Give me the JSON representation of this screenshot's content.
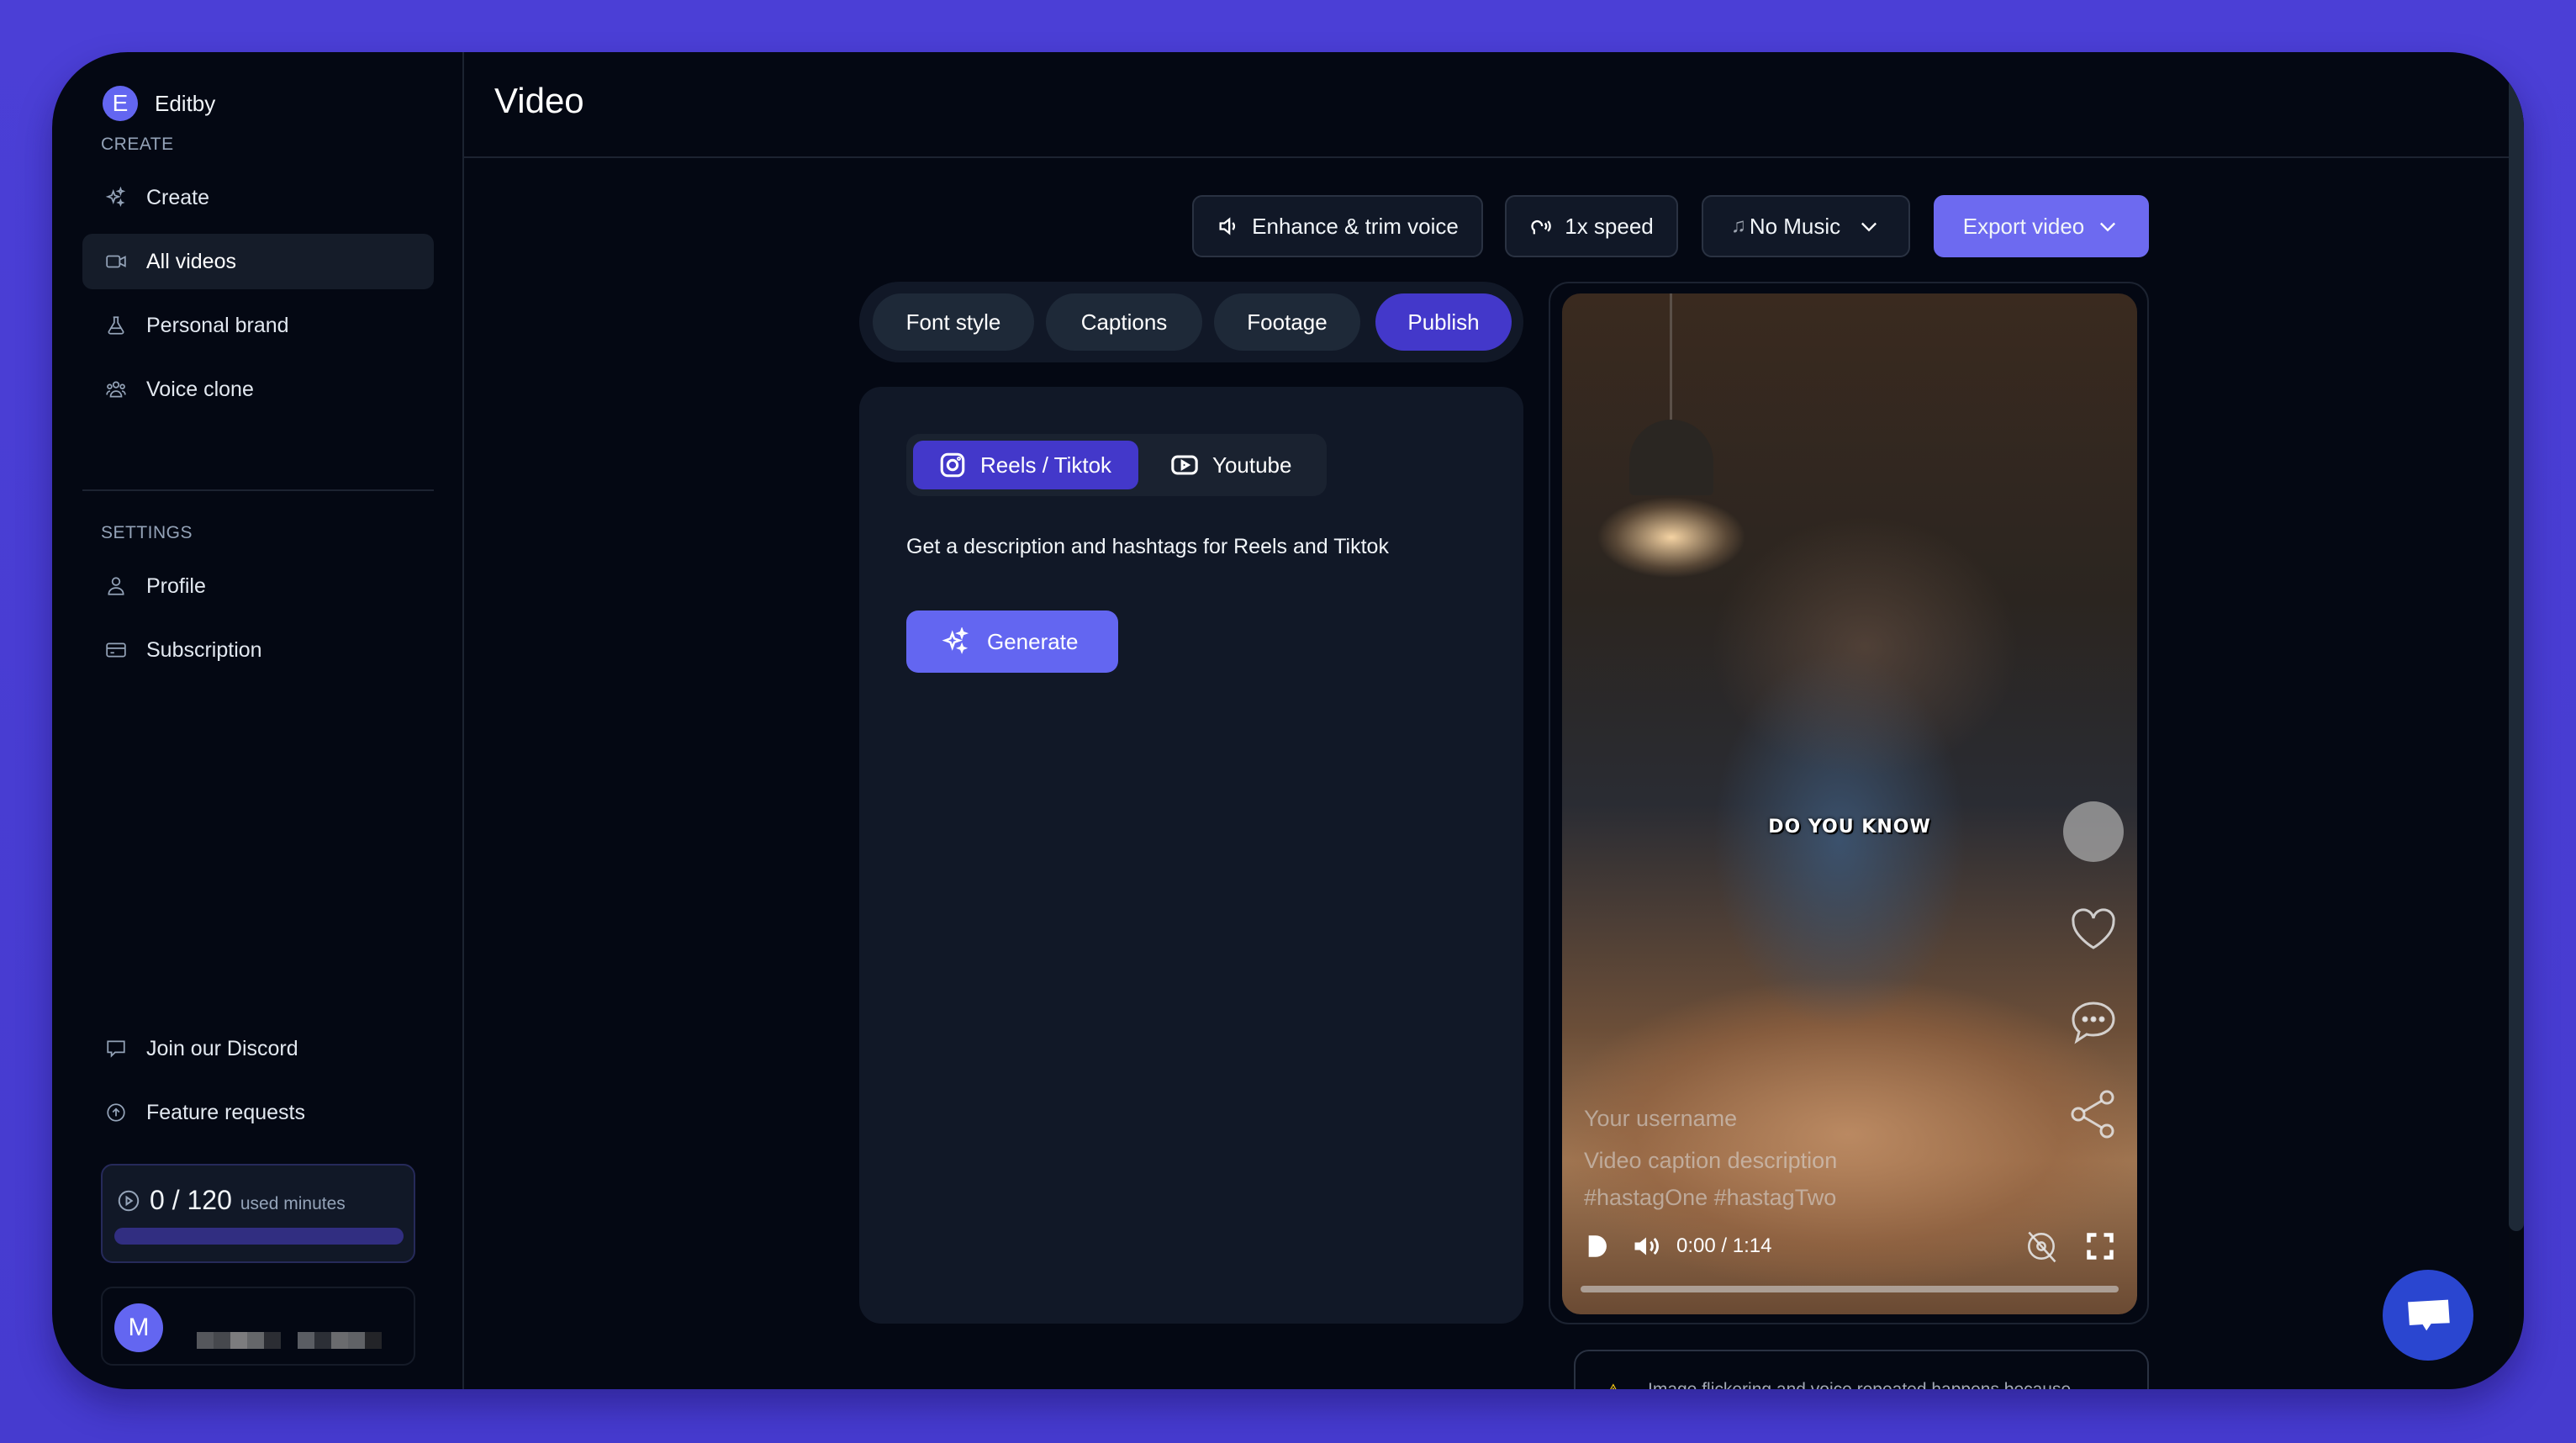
{
  "app": {
    "name": "Editby",
    "logo_letter": "E"
  },
  "sidebar": {
    "create_section": "CREATE",
    "create_items": [
      {
        "label": "Create",
        "icon": "sparkles-icon"
      },
      {
        "label": "All videos",
        "icon": "video-camera-icon",
        "active": true
      },
      {
        "label": "Personal brand",
        "icon": "flask-icon"
      },
      {
        "label": "Voice clone",
        "icon": "users-icon"
      }
    ],
    "settings_section": "SETTINGS",
    "settings_items": [
      {
        "label": "Profile",
        "icon": "user-icon"
      },
      {
        "label": "Subscription",
        "icon": "credit-card-icon"
      }
    ],
    "footer_items": [
      {
        "label": "Join our Discord",
        "icon": "chat-bubble-icon"
      },
      {
        "label": "Feature requests",
        "icon": "arrow-up-circle-icon"
      }
    ],
    "usage": {
      "count": "0 / 120",
      "unit": "used minutes",
      "used": 0,
      "total": 120
    },
    "user": {
      "avatar_letter": "M",
      "name_redacted": true
    }
  },
  "header": {
    "title": "Video"
  },
  "toolbar": {
    "enhance_label": "Enhance & trim voice",
    "speed_label": "1x speed",
    "music_label": "No Music",
    "export_label": "Export video"
  },
  "tabs": [
    {
      "label": "Font style"
    },
    {
      "label": "Captions"
    },
    {
      "label": "Footage"
    },
    {
      "label": "Publish",
      "active": true
    }
  ],
  "publish": {
    "platforms": [
      {
        "label": "Reels / Tiktok",
        "icon": "instagram-icon",
        "active": true
      },
      {
        "label": "Youtube",
        "icon": "youtube-icon"
      }
    ],
    "description": "Get a description and hashtags for Reels and Tiktok",
    "generate_label": "Generate"
  },
  "preview": {
    "overlay_title": "DO YOU KNOW",
    "username": "Your username",
    "caption": "Video caption description",
    "hashtags": "#hastagOne #hastagTwo",
    "time": "0:00 / 1:14",
    "progress": 0
  },
  "warning": {
    "text": "Image flickering and voice repeated happens because"
  },
  "colors": {
    "accent": "#6366f1",
    "accent_dark": "#4338ca",
    "background": "#040813",
    "frame": "#4b3fd6",
    "chat_fab": "#2a46d0",
    "warning": "#facc15"
  }
}
